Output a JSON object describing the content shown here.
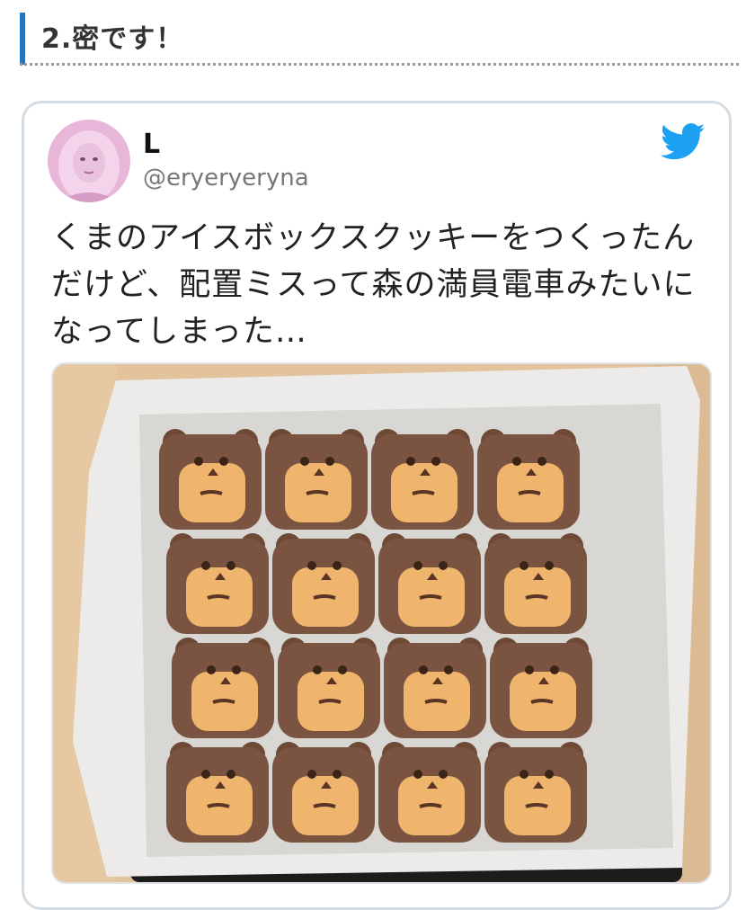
{
  "section": {
    "heading": "2.密です！",
    "accent_color": "#1f78c1"
  },
  "tweet": {
    "display_name": "L",
    "handle": "@eryeryeryna",
    "text_lines": [
      "くまのアイスボックスクッキーをつくったん",
      "だけど、配置ミスって森の満員電車みたいに",
      "なってしまった…"
    ],
    "brand_icon": "twitter-bird-icon",
    "brand_color": "#1da1f2",
    "image": {
      "subject": "bear-face-cookies",
      "grid": {
        "rows": 4,
        "cols": 4
      }
    }
  }
}
